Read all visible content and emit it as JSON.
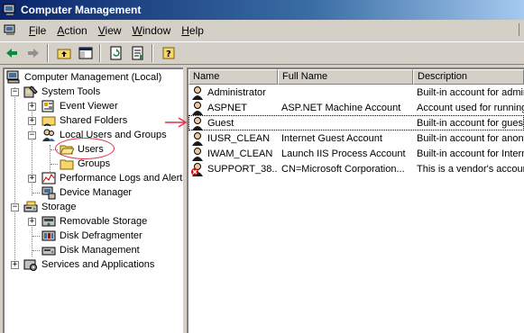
{
  "window": {
    "title": "Computer Management"
  },
  "menu": [
    {
      "pre": "",
      "ul": "F",
      "post": "ile"
    },
    {
      "pre": "",
      "ul": "A",
      "post": "ction"
    },
    {
      "pre": "",
      "ul": "V",
      "post": "iew"
    },
    {
      "pre": "",
      "ul": "W",
      "post": "indow"
    },
    {
      "pre": "",
      "ul": "H",
      "post": "elp"
    }
  ],
  "tree": {
    "root": "Computer Management (Local)",
    "system_tools": "System Tools",
    "event_viewer": "Event Viewer",
    "shared_folders": "Shared Folders",
    "local_users": "Local Users and Groups",
    "users": "Users",
    "groups": "Groups",
    "perf_logs": "Performance Logs and Alerts",
    "device_manager": "Device Manager",
    "storage": "Storage",
    "removable_storage": "Removable Storage",
    "disk_defrag": "Disk Defragmenter",
    "disk_mgmt": "Disk Management",
    "services": "Services and Applications"
  },
  "list": {
    "columns": [
      "Name",
      "Full Name",
      "Description"
    ],
    "rows": [
      {
        "name": "Administrator",
        "full": "",
        "desc": "Built-in account for administering",
        "disabled": false
      },
      {
        "name": "ASPNET",
        "full": "ASP.NET Machine Account",
        "desc": "Account used for running",
        "disabled": false
      },
      {
        "name": "Guest",
        "full": "",
        "desc": "Built-in account for guest",
        "disabled": false
      },
      {
        "name": "IUSR_CLEAN",
        "full": "Internet Guest Account",
        "desc": "Built-in account for anonymous",
        "disabled": false
      },
      {
        "name": "IWAM_CLEAN",
        "full": "Launch IIS Process Account",
        "desc": "Built-in account for Internet",
        "disabled": false
      },
      {
        "name": "SUPPORT_38...",
        "full": "CN=Microsoft Corporation...",
        "desc": "This is a vendor's account",
        "disabled": true
      }
    ]
  },
  "colors": {
    "annotation": "#e0304a",
    "title_bar": "#0a246a"
  }
}
